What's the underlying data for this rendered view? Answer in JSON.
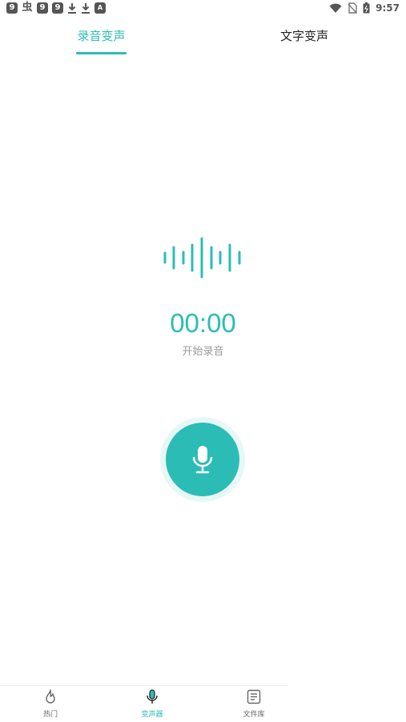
{
  "status_bar": {
    "time": "9:57",
    "left_icons": [
      "9",
      "虫",
      "9",
      "9",
      "download-icon",
      "download-icon",
      "A"
    ]
  },
  "tabs": {
    "record": "录音变声",
    "text": "文字变声"
  },
  "recorder": {
    "timer": "00:00",
    "hint": "开始录音"
  },
  "bottom_nav": {
    "hot": "热门",
    "changer": "变声器",
    "files": "文件库"
  },
  "colors": {
    "accent": "#2bbdb5",
    "accent_light": "#e6f7f6"
  }
}
